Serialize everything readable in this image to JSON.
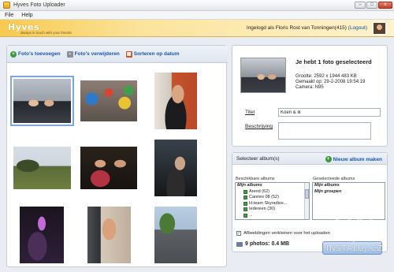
{
  "window": {
    "title": "Hyves Foto Uploader",
    "minimize_glyph": "–",
    "maximize_glyph": "□",
    "close_glyph": "x"
  },
  "menu": [
    {
      "label": "File"
    },
    {
      "label": "Help"
    }
  ],
  "banner": {
    "logo": "Hyves",
    "tagline": "always in touch with your friends",
    "login_text": "Ingelogd als Floris Rost van Tonningen(415)",
    "logout": "(Logout)"
  },
  "toolbar": {
    "add_label": "Foto's toevoegen",
    "remove_label": "Foto's verwijderen",
    "sort_label": "Sorteren op datum"
  },
  "photos": [
    {
      "selected": true
    },
    {
      "selected": false
    },
    {
      "selected": false
    },
    {
      "selected": false
    },
    {
      "selected": false
    },
    {
      "selected": false
    },
    {
      "selected": false
    },
    {
      "selected": false
    },
    {
      "selected": false
    }
  ],
  "info": {
    "heading": "Je hebt 1 foto geselecteerd",
    "size": "Grootte: 2592 x 1944 483 KB",
    "made": "Gemaakt op: 29-2-2008 19:54:19",
    "camera": "Camera: N95",
    "title_label": "Titel",
    "title_value": "Koen & ik",
    "description_label": "Beschrijving",
    "description_value": ""
  },
  "albums": {
    "select_label": "Selecteer album(s)",
    "new_album": "Nieuw album maken",
    "available_caption": "Beschikbare albums",
    "selected_caption": "Geselecteede albums",
    "available": [
      {
        "label": "Mijn albums",
        "group": true
      },
      {
        "label": "Arend (62)",
        "group": false
      },
      {
        "label": "Cannes 08 (52)",
        "group": false
      },
      {
        "label": "H-team Skyradiox...",
        "group": false
      },
      {
        "label": "Iedereen (30)",
        "group": false
      },
      {
        "label": "...",
        "group": false
      }
    ],
    "selected": [
      {
        "label": "Mijn albums",
        "group": true
      },
      {
        "label": "Mijn groepen",
        "group": true
      }
    ],
    "resize_label": "Afbeeldingen verkleinen voor het uploaden",
    "resize_checked": true,
    "summary": "9 photos: 0.4 MB"
  },
  "watermark": "INSTALUJ.CZ"
}
